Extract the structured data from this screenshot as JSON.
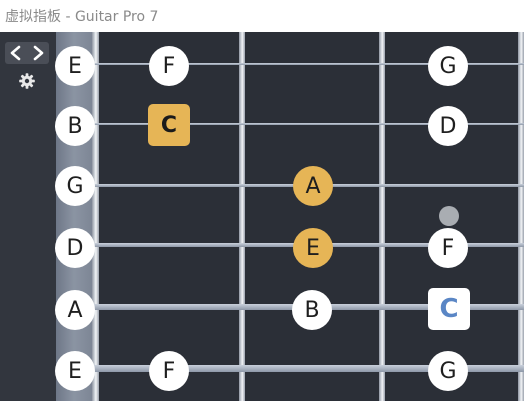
{
  "window": {
    "title": "虚拟指板 - Guitar Pro 7"
  },
  "sidebar": {
    "icons": [
      "chevron-left-icon",
      "chevron-right-icon",
      "gear-icon"
    ]
  },
  "colors": {
    "scale_note": "#e6b556",
    "root_alt_text": "#5a86c5",
    "board": "#2b2f37",
    "sidebar": "#32363e"
  },
  "fretboard": {
    "open_strings": [
      "E",
      "B",
      "G",
      "D",
      "A",
      "E"
    ],
    "notes": {
      "s1_f1": "F",
      "s1_f3": "G",
      "s2_f1": "C",
      "s2_f3": "D",
      "s3_f2": "A",
      "s4_f2": "E",
      "s4_f3": "F",
      "s5_f2": "B",
      "s5_f3": "C",
      "s6_f1": "F",
      "s6_f3": "G"
    }
  }
}
